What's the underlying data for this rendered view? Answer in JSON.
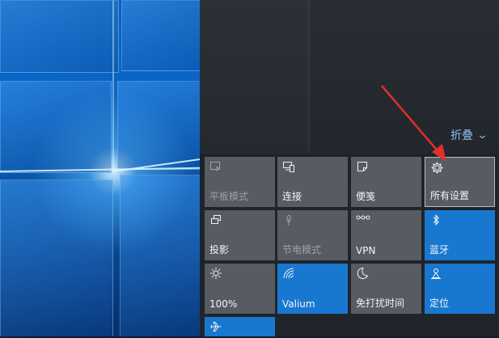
{
  "action_center": {
    "collapse_label": "折叠",
    "tiles": [
      {
        "label": "平板模式",
        "icon": "tablet-mode-icon",
        "state": "disabled"
      },
      {
        "label": "连接",
        "icon": "connect-icon",
        "state": "off"
      },
      {
        "label": "便笺",
        "icon": "note-icon",
        "state": "off"
      },
      {
        "label": "所有设置",
        "icon": "gear-icon",
        "state": "selected"
      },
      {
        "label": "投影",
        "icon": "project-icon",
        "state": "off"
      },
      {
        "label": "节电模式",
        "icon": "battery-saver-icon",
        "state": "disabled"
      },
      {
        "label": "VPN",
        "icon": "vpn-icon",
        "state": "off"
      },
      {
        "label": "蓝牙",
        "icon": "bluetooth-icon",
        "state": "on"
      },
      {
        "label": "100%",
        "icon": "brightness-icon",
        "state": "off"
      },
      {
        "label": "Valium",
        "icon": "wifi-icon",
        "state": "on"
      },
      {
        "label": "免打扰时间",
        "icon": "quiet-hours-moon-icon",
        "state": "off"
      },
      {
        "label": "定位",
        "icon": "location-icon",
        "state": "on"
      },
      {
        "label": "",
        "icon": "airplane-mode-icon",
        "state": "on"
      }
    ]
  },
  "colors": {
    "tile_on": "#1878d0",
    "tile_off": "#565c61",
    "annotation_arrow": "#e0312a",
    "link": "#8db9e6"
  }
}
